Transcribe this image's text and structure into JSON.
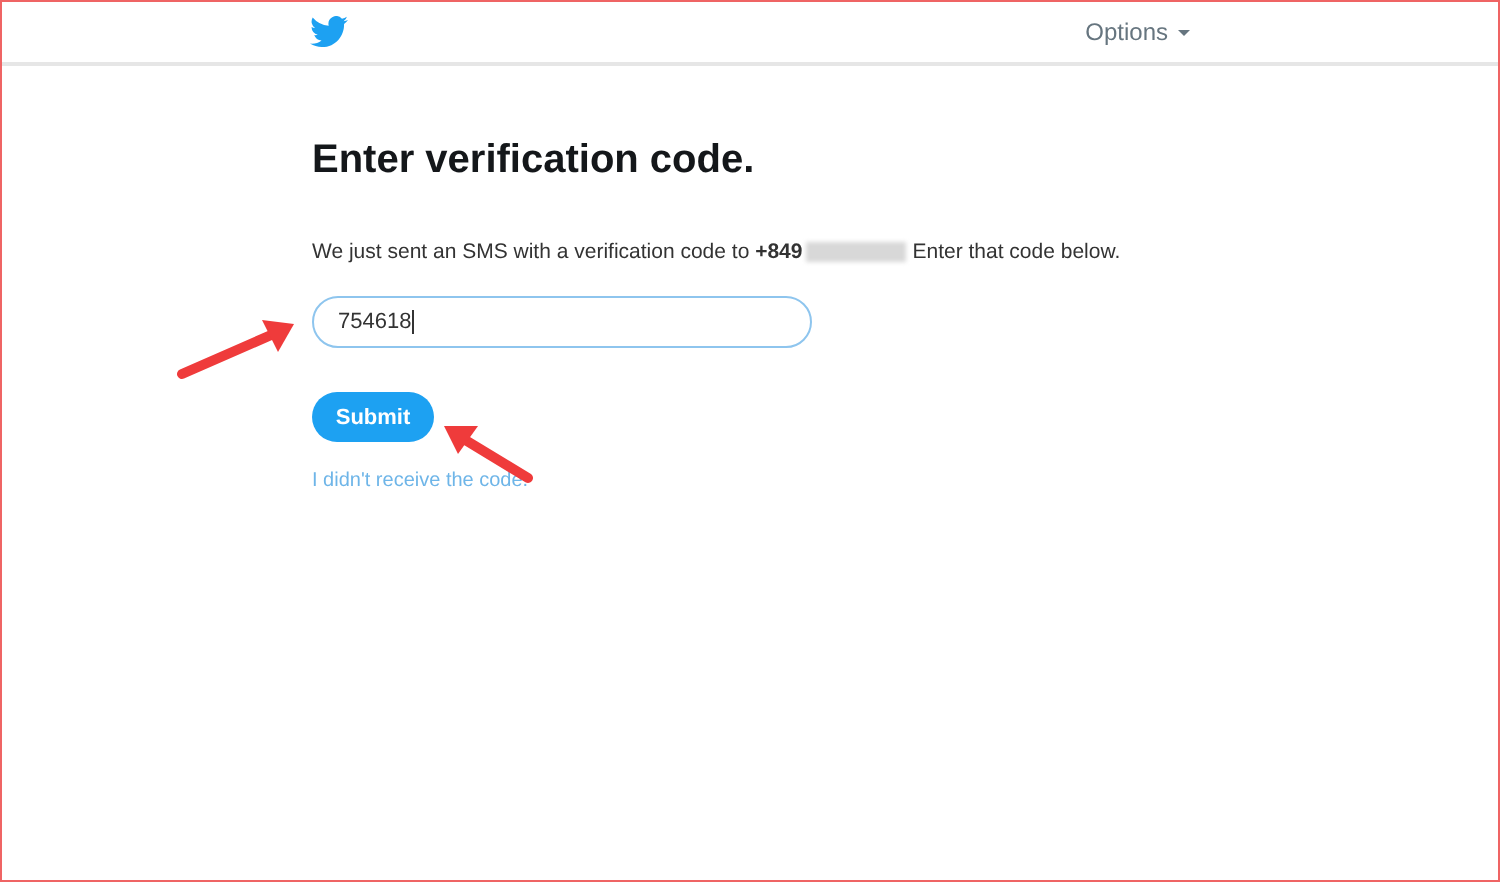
{
  "header": {
    "options": "Options"
  },
  "heading": "Enter verification code.",
  "message": {
    "before": "We just sent an SMS with a verification code to **+849**",
    "after": "Enter that code below."
  },
  "code_field": {
    "value": "754618"
  },
  "submit": "Submit",
  "link": "I didn't receive the code."
}
